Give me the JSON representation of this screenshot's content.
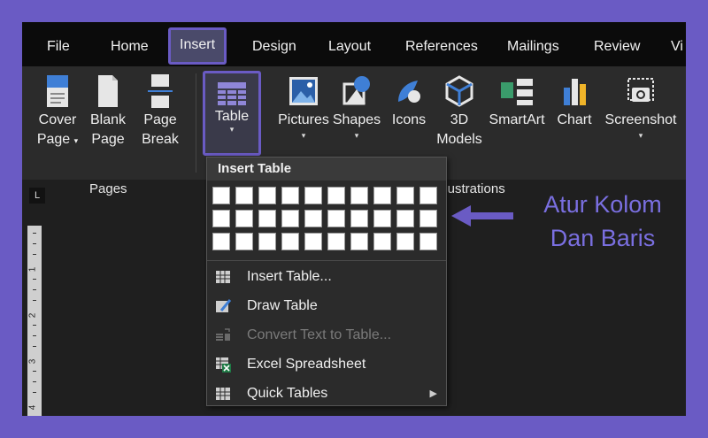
{
  "tabs": [
    "File",
    "Home",
    "Insert",
    "Design",
    "Layout",
    "References",
    "Mailings",
    "Review",
    "Vi"
  ],
  "active_tab": "Insert",
  "ribbon": {
    "pages": {
      "group_label": "Pages",
      "cover_page": [
        "Cover",
        "Page"
      ],
      "blank_page": [
        "Blank",
        "Page"
      ],
      "page_break": [
        "Page",
        "Break"
      ]
    },
    "table": {
      "label": "Table"
    },
    "illustrations": {
      "group_label_visible": "llustrations",
      "pictures": "Pictures",
      "shapes": "Shapes",
      "icons": "Icons",
      "models": [
        "3D",
        "Models"
      ],
      "smartart": "SmartArt",
      "chart": "Chart",
      "screenshot": "Screenshot"
    }
  },
  "ruler": {
    "corner": "L",
    "numbers": [
      "1",
      "2",
      "3",
      "4"
    ]
  },
  "insert_table_menu": {
    "header": "Insert Table",
    "grid": {
      "columns": 10,
      "rows": 3
    },
    "items": [
      {
        "label": "Insert Table...",
        "icon": "table-icon",
        "enabled": true
      },
      {
        "label": "Draw Table",
        "icon": "pencil-table-icon",
        "enabled": true
      },
      {
        "label": "Convert Text to Table...",
        "icon": "convert-text-icon",
        "enabled": false
      },
      {
        "label": "Excel Spreadsheet",
        "icon": "excel-icon",
        "enabled": true
      },
      {
        "label": "Quick Tables",
        "icon": "table-icon",
        "enabled": true,
        "submenu": true
      }
    ]
  },
  "callout": {
    "line1": "Atur Kolom",
    "line2": "Dan Baris"
  },
  "colors": {
    "accent": "#6a5bc4",
    "callout_text": "#7a6fe0",
    "ribbon_bg": "#2b2b2b",
    "tab_bar_bg": "#0b0b0b"
  }
}
